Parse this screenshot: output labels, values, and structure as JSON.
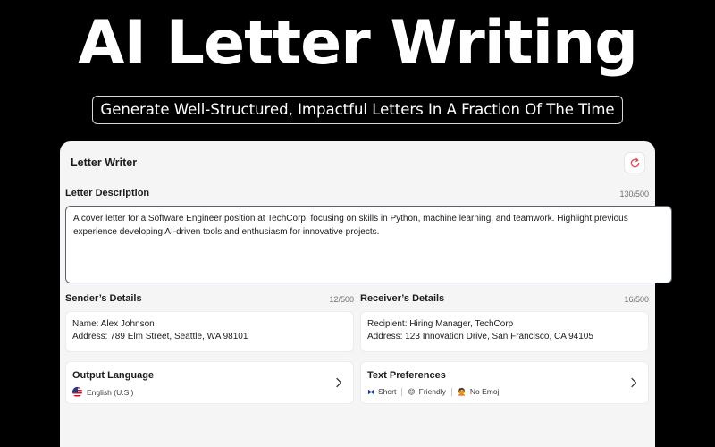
{
  "hero": {
    "title": "AI Letter Writing",
    "subtitle": "Generate Well-Structured, Impactful Letters In A Fraction Of The Time"
  },
  "window": {
    "title": "Letter Writer",
    "refresh_icon": "refresh-icon",
    "accent_color": "#e0454f"
  },
  "description": {
    "label": "Letter Description",
    "counter": "130/500",
    "value": "A cover letter for a Software Engineer position at TechCorp, focusing on skills in Python, machine learning, and teamwork. Highlight previous experience developing AI-driven tools and enthusiasm for innovative projects."
  },
  "sender": {
    "label": "Sender’s Details",
    "counter": "12/500",
    "line1": "Name: Alex Johnson",
    "line2": "Address: 789 Elm Street, Seattle, WA 98101"
  },
  "receiver": {
    "label": "Receiver’s Details",
    "counter": "16/500",
    "line1": "Recipient: Hiring Manager, TechCorp",
    "line2": "Address: 123 Innovation Drive, San Francisco, CA 94105"
  },
  "output_language": {
    "title": "Output Language",
    "value": "English (U.S.)",
    "icon": "us-flag-icon"
  },
  "text_preferences": {
    "title": "Text Preferences",
    "items": [
      {
        "icon": "bowtie-icon",
        "glyph": "⧓",
        "label": "Short"
      },
      {
        "icon": "smiley-icon",
        "glyph": "😊",
        "label": "Friendly"
      },
      {
        "icon": "no-emoji-icon",
        "glyph": "🙅",
        "label": "No Emoji"
      }
    ]
  }
}
